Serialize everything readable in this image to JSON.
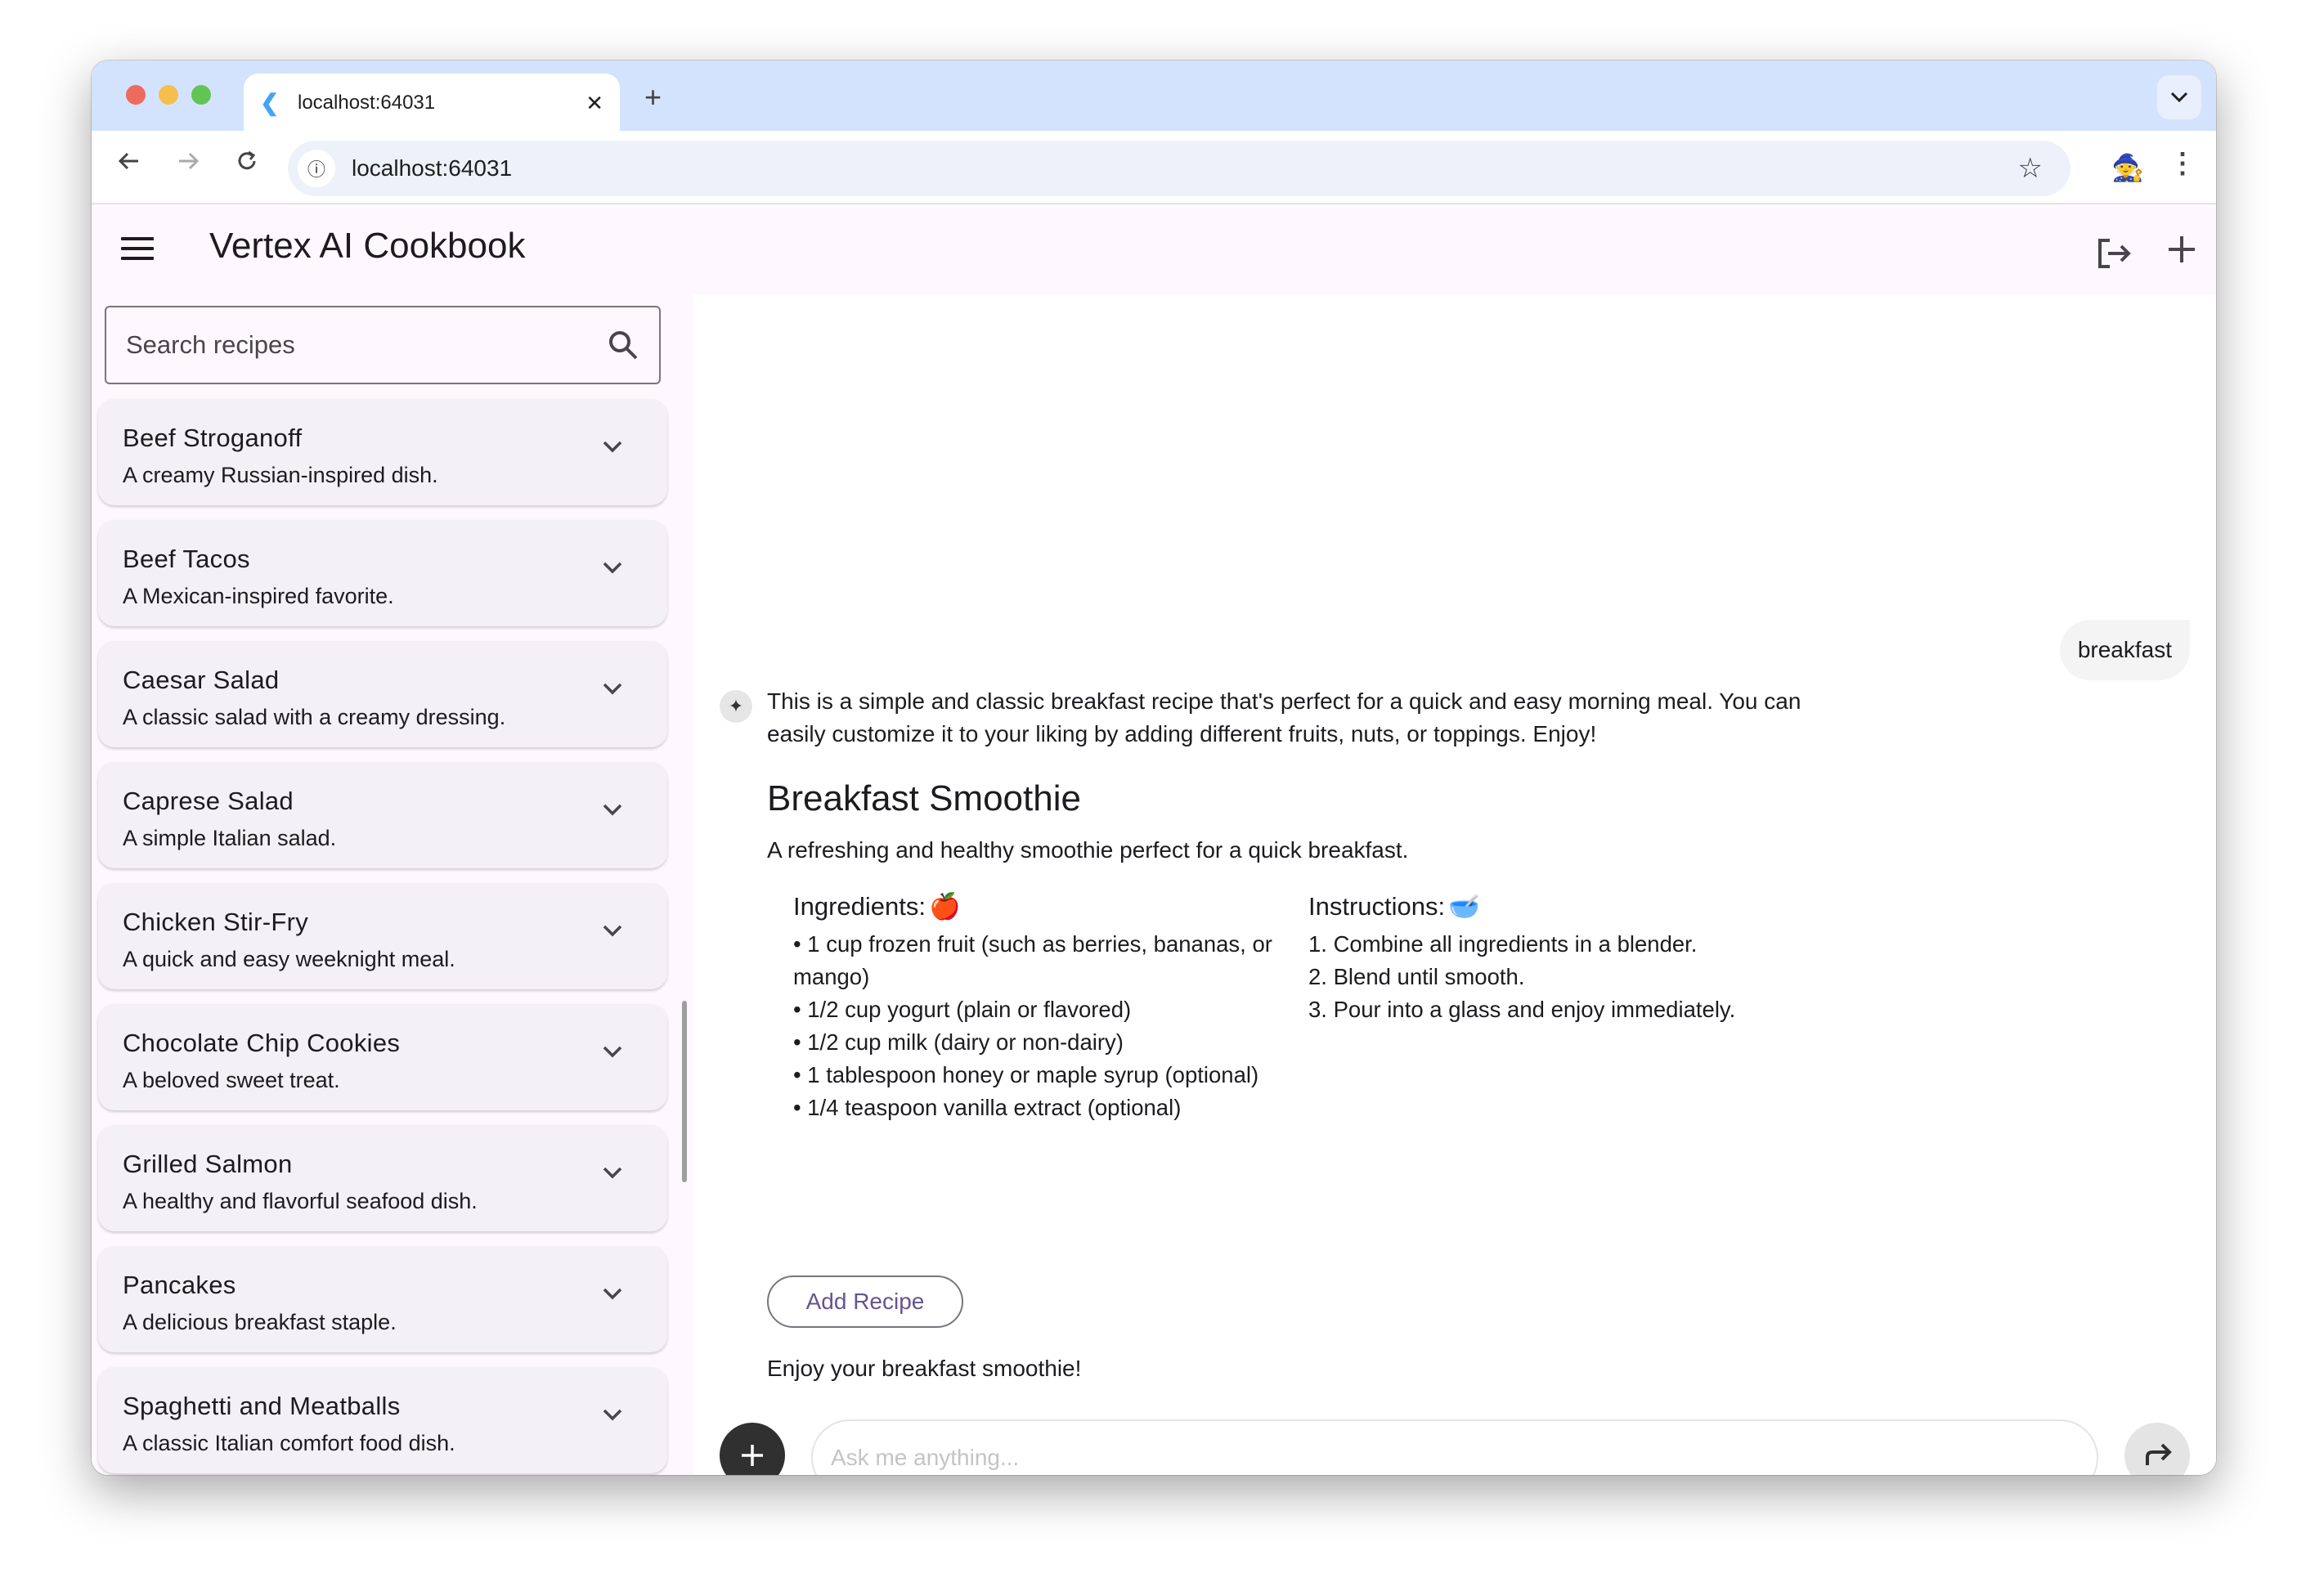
{
  "browser": {
    "tab_title": "localhost:64031",
    "url": "localhost:64031",
    "new_tab_symbol": "+",
    "close_symbol": "✕"
  },
  "app": {
    "title": "Vertex AI Cookbook",
    "accent_color": "#65558f"
  },
  "sidebar": {
    "search_placeholder": "Search recipes",
    "recipes": [
      {
        "name": "Beef Stroganoff",
        "description": "A creamy Russian-inspired dish."
      },
      {
        "name": "Beef Tacos",
        "description": "A Mexican-inspired favorite."
      },
      {
        "name": "Caesar Salad",
        "description": "A classic salad with a creamy dressing."
      },
      {
        "name": "Caprese Salad",
        "description": "A simple Italian salad."
      },
      {
        "name": "Chicken Stir-Fry",
        "description": "A quick and easy weeknight meal."
      },
      {
        "name": "Chocolate Chip Cookies",
        "description": "A beloved sweet treat."
      },
      {
        "name": "Grilled Salmon",
        "description": "A healthy and flavorful seafood dish."
      },
      {
        "name": "Pancakes",
        "description": "A delicious breakfast staple."
      },
      {
        "name": "Spaghetti and Meatballs",
        "description": "A classic Italian comfort food dish."
      }
    ]
  },
  "chat": {
    "user_message": "breakfast",
    "ai_intro": "This is a simple and classic breakfast recipe that's perfect for a quick and easy morning meal. You can easily customize it to your liking by adding different fruits, nuts, or toppings. Enjoy!",
    "recipe": {
      "title": "Breakfast Smoothie",
      "description": "A refreshing and healthy smoothie perfect for a quick breakfast.",
      "ingredients_heading": "Ingredients:",
      "ingredients_emoji": "🍎",
      "ingredients": [
        "• 1 cup frozen fruit (such as berries, bananas, or mango)",
        "• 1/2 cup yogurt (plain or flavored)",
        "• 1/2 cup milk (dairy or non-dairy)",
        "• 1 tablespoon honey or maple syrup (optional)",
        "• 1/4 teaspoon vanilla extract (optional)"
      ],
      "instructions_heading": "Instructions:",
      "instructions_emoji": "🥣",
      "instructions": [
        "1. Combine all ingredients in a blender.",
        "2. Blend until smooth.",
        "3. Pour into a glass and enjoy immediately."
      ],
      "add_button_label": "Add Recipe"
    },
    "closing": "Enjoy your breakfast smoothie!",
    "input_placeholder": "Ask me anything..."
  }
}
